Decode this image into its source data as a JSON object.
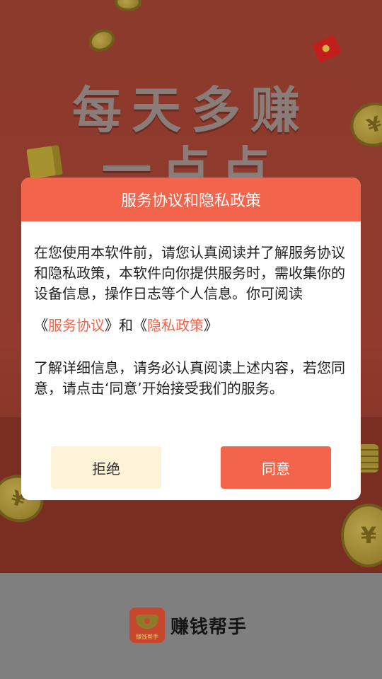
{
  "background": {
    "slogan_line1": "每天多赚",
    "slogan_line2": "一点点",
    "coin_symbol": "¥"
  },
  "dialog": {
    "title": "服务协议和隐私政策",
    "paragraph1": "在您使用本软件前，请您认真阅读并了解服务协议和隐私政策，本软件向你提供服务时，需收集你的设备信息，操作日志等个人信息。你可阅读",
    "links": {
      "open1": "《",
      "service_agreement": "服务协议",
      "close1": "》",
      "and": "和",
      "open2": "《",
      "privacy_policy": "隐私政策",
      "close2": "》"
    },
    "paragraph2": "了解详细信息，请务必认真阅读上述内容，若您同意，请点击‘同意’开始接受我们的服务。",
    "reject_label": "拒绝",
    "agree_label": "同意"
  },
  "brand": {
    "logo_icon": "gold-ingot-icon",
    "logo_tag": "赚钱帮手",
    "name": "赚钱帮手"
  },
  "colors": {
    "accent": "#f2654c",
    "reject_bg": "#fdf3d9"
  }
}
